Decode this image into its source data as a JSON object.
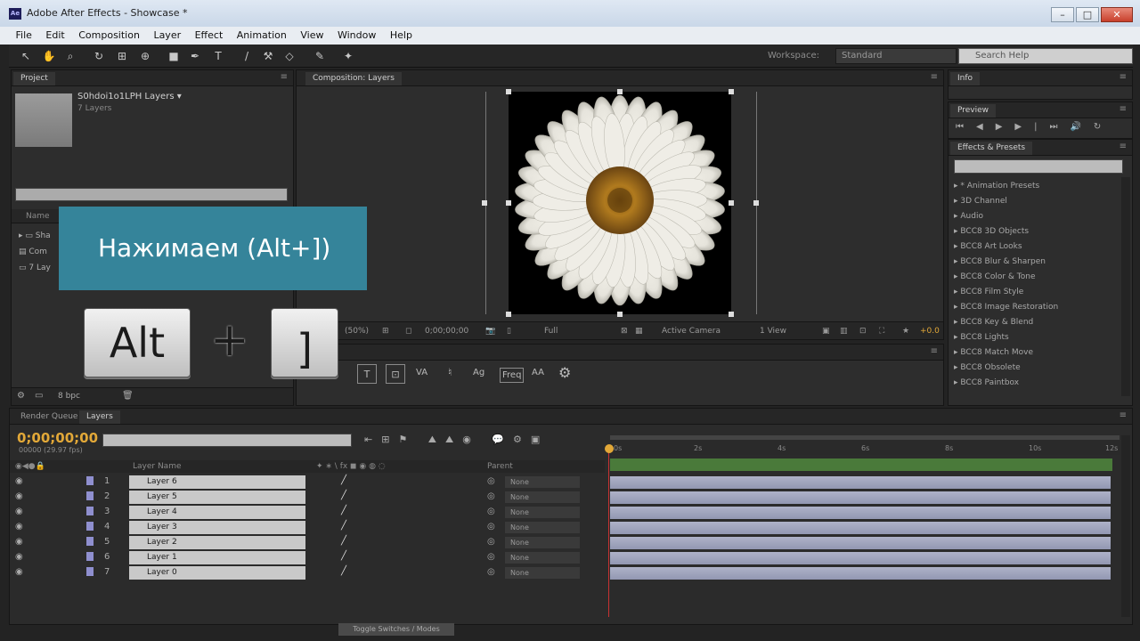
{
  "window": {
    "app_icon": "Ae",
    "title": "Adobe After Effects - Showcase *",
    "minimize": "–",
    "maximize": "□",
    "close": "✕"
  },
  "menu": [
    "File",
    "Edit",
    "Composition",
    "Layer",
    "Effect",
    "Animation",
    "View",
    "Window",
    "Help"
  ],
  "toolbar": {
    "workspace_label": "Workspace:",
    "workspace_value": "Standard",
    "search_help": "Search Help"
  },
  "project": {
    "tab": "Project",
    "comp_name": "S0hdoi1o1LPH Layers ▾",
    "comp_sub": "7 Layers",
    "col_name": "Name",
    "rows": [
      "Sha",
      "Com",
      "7 Lay"
    ],
    "footer_bpc": "8 bpc"
  },
  "composition": {
    "tab": "Composition: Layers",
    "zoom": "(50%)",
    "timecode": "0;00;00;00",
    "resolution": "Full",
    "camera": "Active Camera",
    "views": "1 View",
    "offset": "+0.0"
  },
  "character": {
    "labels": [
      "VA",
      "Ag",
      "Freq",
      "AA"
    ]
  },
  "info_panel": {
    "tab": "Info"
  },
  "preview_panel": {
    "tab": "Preview"
  },
  "effects_panel": {
    "tab": "Effects & Presets",
    "items": [
      "* Animation Presets",
      "3D Channel",
      "Audio",
      "BCC8 3D Objects",
      "BCC8 Art Looks",
      "BCC8 Blur & Sharpen",
      "BCC8 Color & Tone",
      "BCC8 Film Style",
      "BCC8 Image Restoration",
      "BCC8 Key & Blend",
      "BCC8 Lights",
      "BCC8 Match Move",
      "BCC8 Obsolete",
      "BCC8 Paintbox"
    ]
  },
  "timeline": {
    "tabs": [
      "Render Queue",
      "Layers"
    ],
    "timecode": "0;00;00;00",
    "fps": "00000 (29.97 fps)",
    "col_layer_name": "Layer Name",
    "col_parent": "Parent",
    "ruler": [
      "0s",
      "2s",
      "4s",
      "6s",
      "8s",
      "10s",
      "12s"
    ],
    "toggle_label": "Toggle Switches / Modes",
    "layers": [
      {
        "num": "1",
        "name": "Layer 6",
        "mode": "None"
      },
      {
        "num": "2",
        "name": "Layer 5",
        "mode": "None"
      },
      {
        "num": "3",
        "name": "Layer 4",
        "mode": "None"
      },
      {
        "num": "4",
        "name": "Layer 3",
        "mode": "None"
      },
      {
        "num": "5",
        "name": "Layer 2",
        "mode": "None"
      },
      {
        "num": "6",
        "name": "Layer 1",
        "mode": "None"
      },
      {
        "num": "7",
        "name": "Layer 0",
        "mode": "None"
      }
    ]
  },
  "overlay": {
    "text": "Нажимаем (Alt+])",
    "key1": "Alt",
    "plus": "+",
    "key2": "]"
  },
  "colors": {
    "timecode": "#e2a838",
    "overlay_bg": "#35849a",
    "layer_bar": "#a3a7c0",
    "playhead": "#c83232"
  }
}
